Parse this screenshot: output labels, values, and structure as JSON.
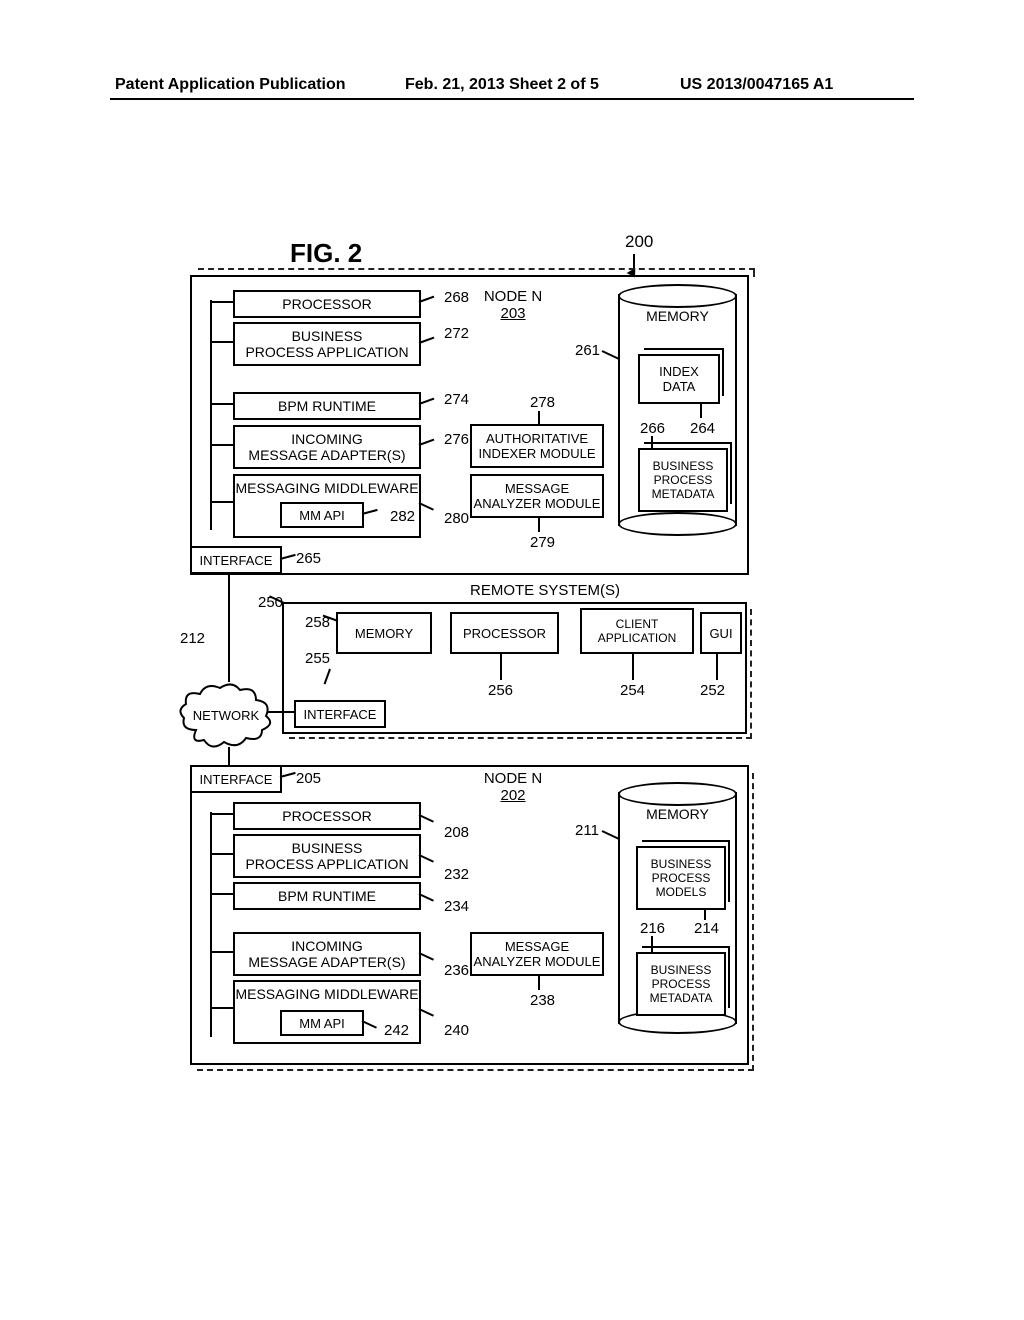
{
  "header": {
    "left": "Patent Application Publication",
    "mid": "Feb. 21, 2013  Sheet 2 of 5",
    "right": "US 2013/0047165 A1"
  },
  "figure_label": "FIG. 2",
  "system_ref": "200",
  "network": "NETWORK",
  "net_ref": "212",
  "node_top": {
    "title": "NODE N",
    "ref": "203",
    "processor": "PROCESSOR",
    "processor_ref": "268",
    "bpa": "BUSINESS\nPROCESS APPLICATION",
    "bpa_ref": "272",
    "bpm": "BPM RUNTIME",
    "bpm_ref": "274",
    "ima": "INCOMING\nMESSAGE ADAPTER(S)",
    "ima_ref": "276",
    "mm": "MESSAGING MIDDLEWARE",
    "mm_ref": "280",
    "mmapi": "MM API",
    "mmapi_ref": "282",
    "aim": "AUTHORITATIVE\nINDEXER MODULE",
    "aim_ref": "278",
    "mam": "MESSAGE\nANALYZER MODULE",
    "mam_ref": "279",
    "memory": "MEMORY",
    "memory_ref": "261",
    "idx": "INDEX\nDATA",
    "idx_ref": "264",
    "bpm_meta": "BUSINESS\nPROCESS\nMETADATA",
    "bpm_meta_ref": "266",
    "interface": "INTERFACE",
    "interface_ref": "265"
  },
  "remote": {
    "title": "REMOTE SYSTEM(S)",
    "ref": "250",
    "memory": "MEMORY",
    "memory_ref": "258",
    "processor": "PROCESSOR",
    "processor_ref": "256",
    "client": "CLIENT\nAPPLICATION",
    "client_ref": "254",
    "gui": "GUI",
    "gui_ref": "252",
    "interface": "INTERFACE",
    "interface_ref": "255"
  },
  "node_bot": {
    "title": "NODE N",
    "ref": "202",
    "interface": "INTERFACE",
    "interface_ref": "205",
    "processor": "PROCESSOR",
    "processor_ref": "208",
    "bpa": "BUSINESS\nPROCESS APPLICATION",
    "bpa_ref": "232",
    "bpm": "BPM RUNTIME",
    "bpm_ref": "234",
    "ima": "INCOMING\nMESSAGE ADAPTER(S)",
    "ima_ref": "236",
    "mm": "MESSAGING MIDDLEWARE",
    "mm_ref": "240",
    "mmapi": "MM API",
    "mmapi_ref": "242",
    "mam": "MESSAGE\nANALYZER MODULE",
    "mam_ref": "238",
    "memory": "MEMORY",
    "memory_ref": "211",
    "models": "BUSINESS\nPROCESS\nMODELS",
    "models_ref": "214",
    "bpm_meta": "BUSINESS\nPROCESS\nMETADATA",
    "bpm_meta_ref": "216"
  }
}
